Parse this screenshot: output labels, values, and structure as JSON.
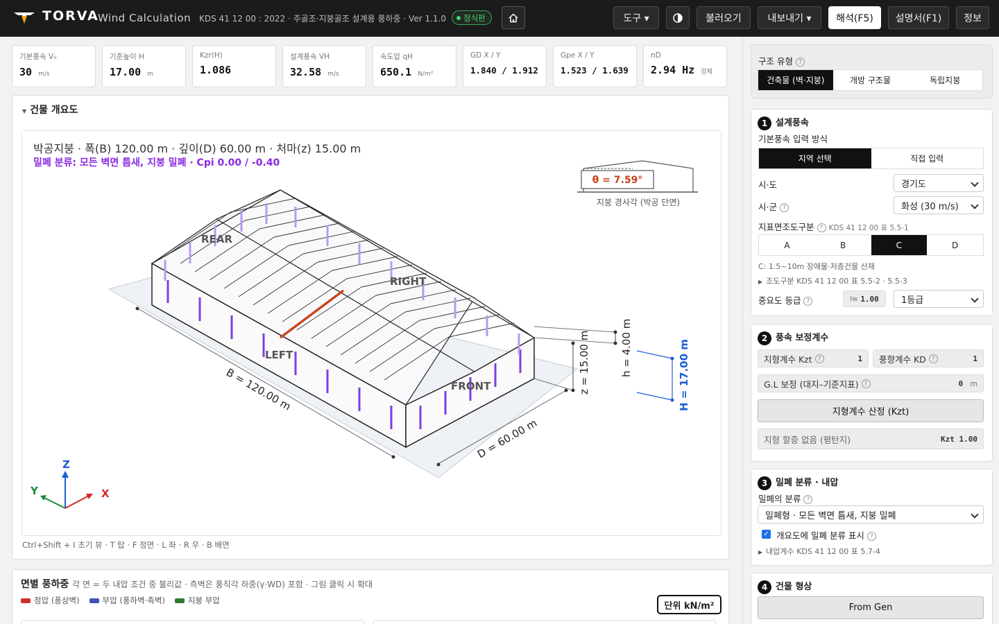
{
  "header": {
    "brand": "TORVA",
    "brand_sub": "Wind Calculation",
    "spec": "KDS 41 12 00 : 2022 · 주골조·지붕골조 설계용 풍하중 · Ver 1.1.0",
    "badge": "정식판",
    "tools_label": "도구 ▾",
    "load_label": "불러오기",
    "export_label": "내보내기 ▾",
    "analyze_label": "해석(F5)",
    "report_label": "설명서(F1)",
    "info_label": "정보"
  },
  "metrics": [
    {
      "label": "기본풍속 V₀",
      "value": "30",
      "unit": "m/s"
    },
    {
      "label": "기준높이 H",
      "value": "17.00",
      "unit": "m"
    },
    {
      "label": "Kzr(H)",
      "value": "1.086",
      "unit": ""
    },
    {
      "label": "설계풍속 VH",
      "value": "32.58",
      "unit": "m/s"
    },
    {
      "label": "속도압 qH",
      "value": "650.1",
      "unit": "N/m²"
    },
    {
      "label": "GD X / Y",
      "value": "1.840 / 1.912",
      "unit": ""
    },
    {
      "label": "Gpe X / Y",
      "value": "1.523 / 1.639",
      "unit": ""
    },
    {
      "label": "nD",
      "value": "2.94 Hz",
      "unit": "강체"
    }
  ],
  "overview": {
    "header": "건물 개요도",
    "title": "박공지붕 · 폭(B) 120.00 m · 깊이(D) 60.00 m · 처마(z) 15.00 m",
    "subtitle": "밀폐 분류: 모든 벽면 틈새, 지붕 밀폐 · Cpi 0.00 / -0.40",
    "theta": "θ = 7.59°",
    "theta_caption": "지붕 경사각 (박공 단면)",
    "labels": {
      "rear": "REAR",
      "right": "RIGHT",
      "left": "LEFT",
      "front": "FRONT"
    },
    "dim_b": "B = 120.00 m",
    "dim_d": "D = 60.00 m",
    "dim_z": "z = 15.00 m",
    "dim_h": "h = 4.00 m",
    "dim_H": "H = 17.00 m",
    "axis_z": "Z",
    "axis_y": "Y",
    "axis_x": "X",
    "shortcut": "Ctrl+Shift + I 초기 뷰 · T 탑 · F 정면 · L 좌 · R 우 · B 배면"
  },
  "pressure": {
    "title": "면별 풍하중",
    "desc": "각 면 = 두 내압 조건 중 불리값 · 측벽은 풍직각 하중(γ·WD) 포함 · 그림 클릭 시 확대",
    "legend": [
      {
        "label": "정압 (풍상벽)",
        "color": "#d32f2f"
      },
      {
        "label": "부압 (풍하벽·측벽)",
        "color": "#3f51b5"
      },
      {
        "label": "지붕 부압",
        "color": "#2e7d32"
      }
    ],
    "unit": "단위 kN/m²"
  },
  "sidebar": {
    "structure_title": "구조 유형",
    "structure_options": [
      "건축물 (벽·지붕)",
      "개방 구조물",
      "독립지붕"
    ],
    "s1_title": "설계풍속",
    "s1_input_method": "기본풍속 입력 방식",
    "s1_method_options": [
      "지역 선택",
      "직접 입력"
    ],
    "sido_label": "시·도",
    "sido_value": "경기도",
    "sigun_label": "시·군",
    "sigun_value": "화성 (30 m/s)",
    "rough_label": "지표면조도구분",
    "rough_ref": "KDS 41 12 00 표 5.5-1",
    "rough_options": [
      "A",
      "B",
      "C",
      "D"
    ],
    "rough_note": "C: 1.5~10m 장애물·저층건물 산재",
    "rough_more": "조도구분 KDS 41 12 00 표 5.5-2 · 5.5-3",
    "importance_label": "중요도 등급",
    "iw_label": "Iw",
    "iw_value": "1.00",
    "importance_value": "1등급",
    "s2_title": "풍속 보정계수",
    "kzt_label": "지형계수 Kzt",
    "kzt_value": "1",
    "kd_label": "풍향계수 KD",
    "kd_value": "1",
    "gl_label": "G.L 보정 (대지–기준지표)",
    "gl_value": "0",
    "gl_unit": "m",
    "kzt_button": "지형계수 산정 (Kzt)",
    "terrain_note": "지형 할증 없음 (평탄지)",
    "terrain_kzt": "Kzt 1.00",
    "s3_title": "밀폐 분류 · 내압",
    "enclosure_label": "밀폐의 분류",
    "enclosure_value": "밀폐형 · 모든 벽면 틈새, 지붕 밀폐",
    "show_enclosure": "개요도에 밀폐 분류 표시",
    "cpi_more": "내압계수 KDS 41 12 00 표 5.7-4",
    "s4_title": "건물 형상",
    "from_gen": "From Gen"
  }
}
